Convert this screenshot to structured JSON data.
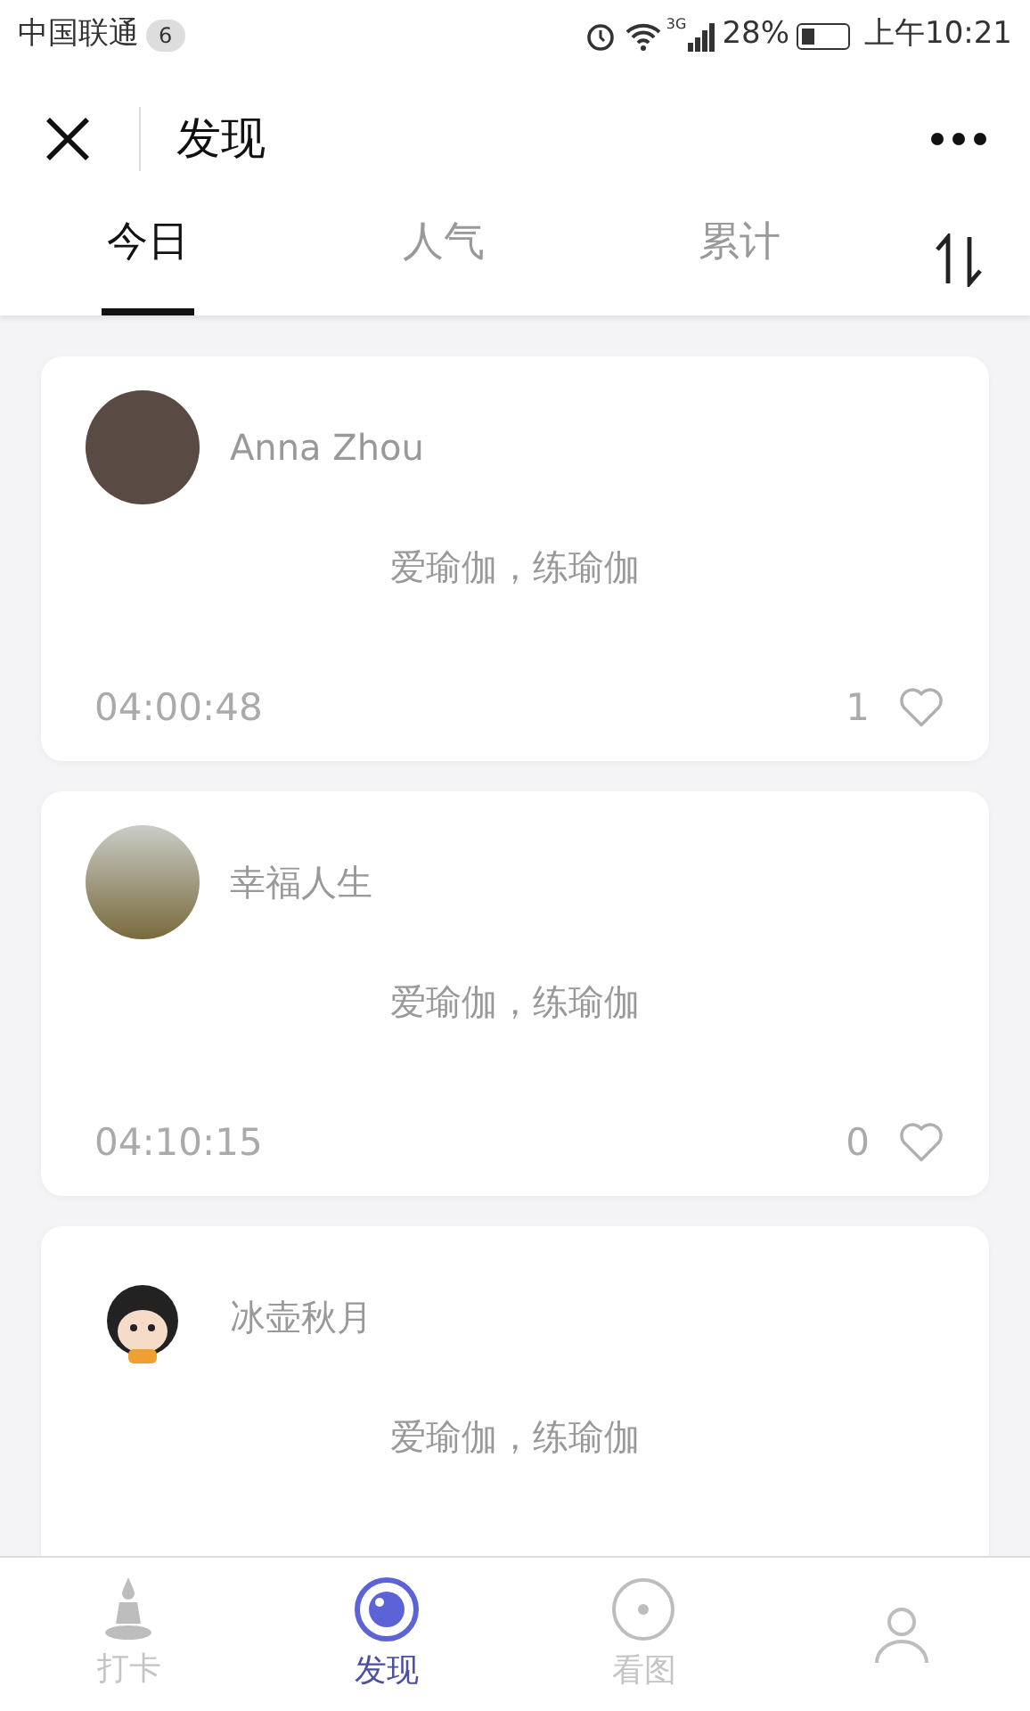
{
  "status_bar": {
    "carrier": "中国联通",
    "badge": "6",
    "network": "3G",
    "battery": "28%",
    "time": "上午10:21"
  },
  "header": {
    "title": "发现"
  },
  "tabs": [
    {
      "label": "今日",
      "selected": true
    },
    {
      "label": "人气",
      "selected": false
    },
    {
      "label": "累计",
      "selected": false
    }
  ],
  "posts": [
    {
      "name": "Anna Zhou",
      "kind": "photo",
      "text": "爱瑜伽，练瑜伽",
      "time": "04:00:48",
      "likes": "1",
      "liked": false
    },
    {
      "name": "幸福人生",
      "kind": "landscape",
      "text": "爱瑜伽，练瑜伽",
      "time": "04:10:15",
      "likes": "0",
      "liked": false
    },
    {
      "name": "冰壶秋月",
      "kind": "cartoon",
      "text": "爱瑜伽，练瑜伽"
    }
  ],
  "bottom_nav": [
    {
      "label": "打卡",
      "kind": "yoga",
      "selected": false
    },
    {
      "label": "发现",
      "kind": "eye",
      "selected": true
    },
    {
      "label": "看图",
      "kind": "circle",
      "selected": false
    },
    {
      "kind": "person",
      "selected": false
    }
  ]
}
